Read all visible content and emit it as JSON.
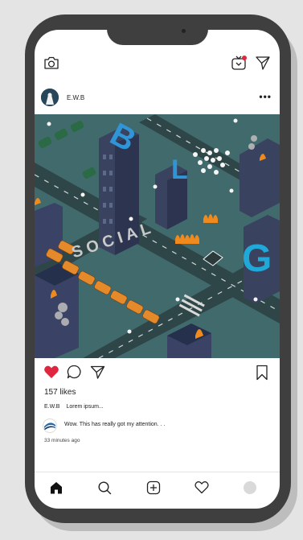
{
  "post": {
    "username": "E.W.B",
    "more_label": "•••",
    "likes": "157 likes",
    "caption_user": "E.W.B",
    "caption_text": "Lorem ipsum...",
    "comment_text": "Wow. This has really got my attention. . .",
    "timestamp": "33 minutes ago"
  },
  "artwork": {
    "letters": [
      "B",
      "L",
      "G"
    ],
    "smoke_word": "S O C I A L"
  },
  "icons": {
    "camera": "camera-icon",
    "igtv": "igtv-icon",
    "direct": "paper-plane-icon",
    "like": "heart-icon",
    "comment": "comment-icon",
    "share": "paper-plane-icon",
    "save": "bookmark-icon",
    "home": "home-icon",
    "search": "search-icon",
    "add": "add-post-icon",
    "activity": "heart-outline-icon",
    "profile": "profile-avatar"
  },
  "colors": {
    "like_red": "#e0263f",
    "notification_red": "#e0263f",
    "phone_frame": "#3f3f3f"
  }
}
